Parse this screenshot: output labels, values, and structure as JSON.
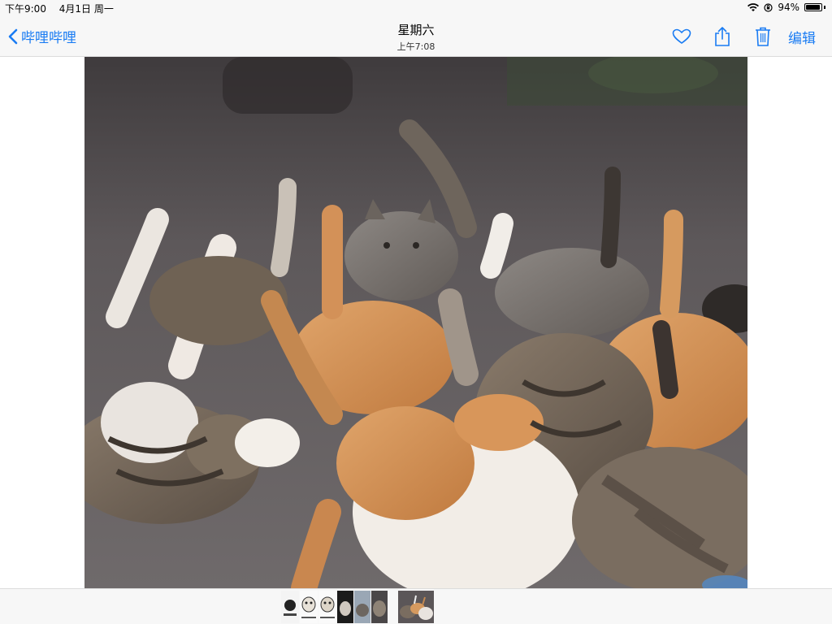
{
  "status_bar": {
    "time": "下午9:00",
    "date": "4月1日 周一",
    "battery": "94%",
    "battery_level": 0.94
  },
  "nav": {
    "back_label": "哔哩哔哩",
    "title": "星期六",
    "subtitle": "上午7:08",
    "edit_label": "编辑"
  },
  "icons": {
    "back": "chevron-left-icon",
    "favorite": "heart-icon",
    "share": "share-icon",
    "delete": "trash-icon"
  },
  "colors": {
    "accent": "#1a7cf3",
    "bar_background": "#f7f7f7"
  },
  "filmstrip": {
    "thumbnail_count": 8,
    "selected_index": 7
  }
}
